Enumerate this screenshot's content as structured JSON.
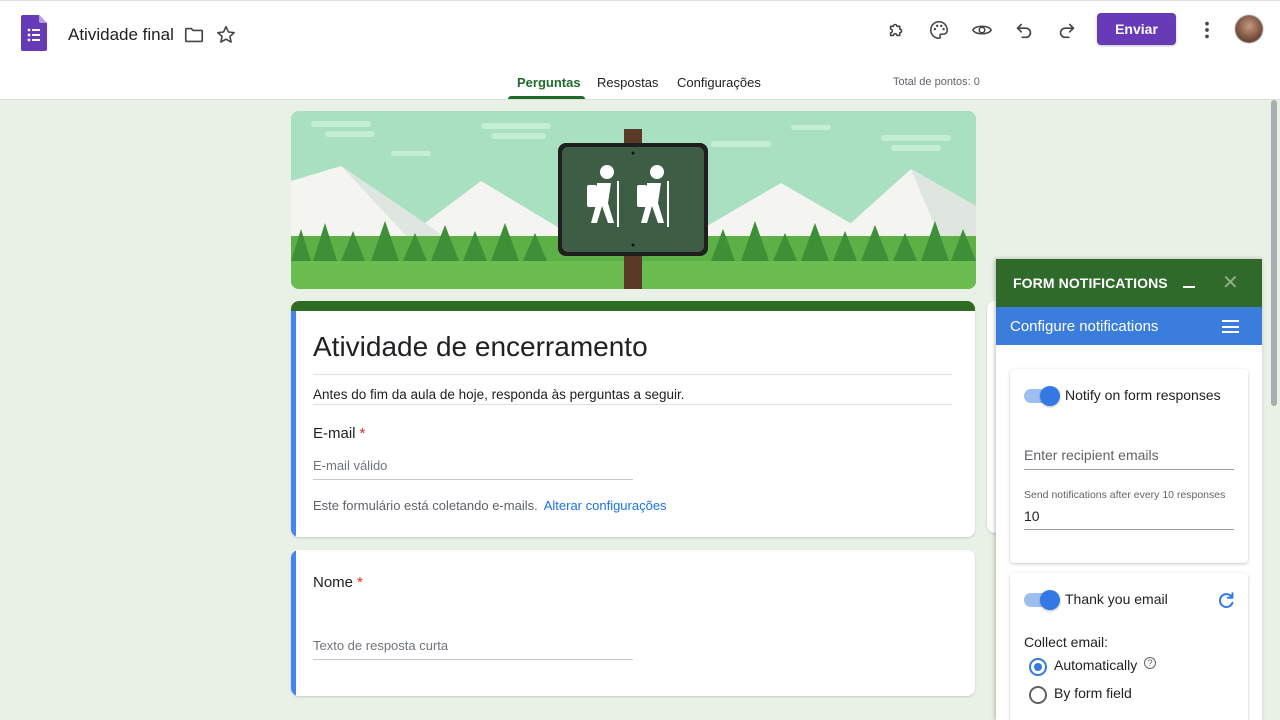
{
  "header": {
    "title": "Atividade final",
    "send_label": "Enviar",
    "tabs": [
      {
        "label": "Perguntas",
        "active": true
      },
      {
        "label": "Respostas",
        "active": false
      },
      {
        "label": "Configurações",
        "active": false
      }
    ],
    "points_label": "Total de pontos: 0",
    "icons": [
      "forms-logo-icon",
      "folder-icon",
      "star-icon",
      "puzzle-icon",
      "palette-icon",
      "eye-icon",
      "undo-icon",
      "redo-icon",
      "more-vert-icon"
    ],
    "accent_color": "#673ab7"
  },
  "form": {
    "title": "Atividade de encerramento",
    "description": "Antes do fim da aula de hoje, responda às perguntas a seguir.",
    "email_question": {
      "label": "E-mail",
      "required_mark": "*",
      "placeholder": "E-mail válido"
    },
    "collect_note": "Este formulário está coletando e-mails.",
    "collect_link": "Alterar configurações",
    "questions": [
      {
        "label": "Nome",
        "required_mark": "*",
        "placeholder": "Texto de resposta curta"
      }
    ],
    "theme_color": "#2e6b23"
  },
  "addon": {
    "title": "FORM NOTIFICATIONS",
    "close_glyph": "✕",
    "subtitle": "Configure notifications",
    "notify": {
      "label": "Notify on form responses",
      "enabled": true,
      "recipient_placeholder": "Enter recipient emails",
      "frequency_label": "Send notifications after every 10 responses",
      "frequency_value": "10"
    },
    "thank_you": {
      "label": "Thank you email",
      "enabled": true,
      "collect_label": "Collect email:",
      "options": [
        {
          "label": "Automatically",
          "selected": true
        },
        {
          "label": "By form field",
          "selected": false
        }
      ],
      "help_glyph": "?"
    },
    "header_color": "#2f6a2b",
    "subheader_color": "#3b7ddd"
  }
}
